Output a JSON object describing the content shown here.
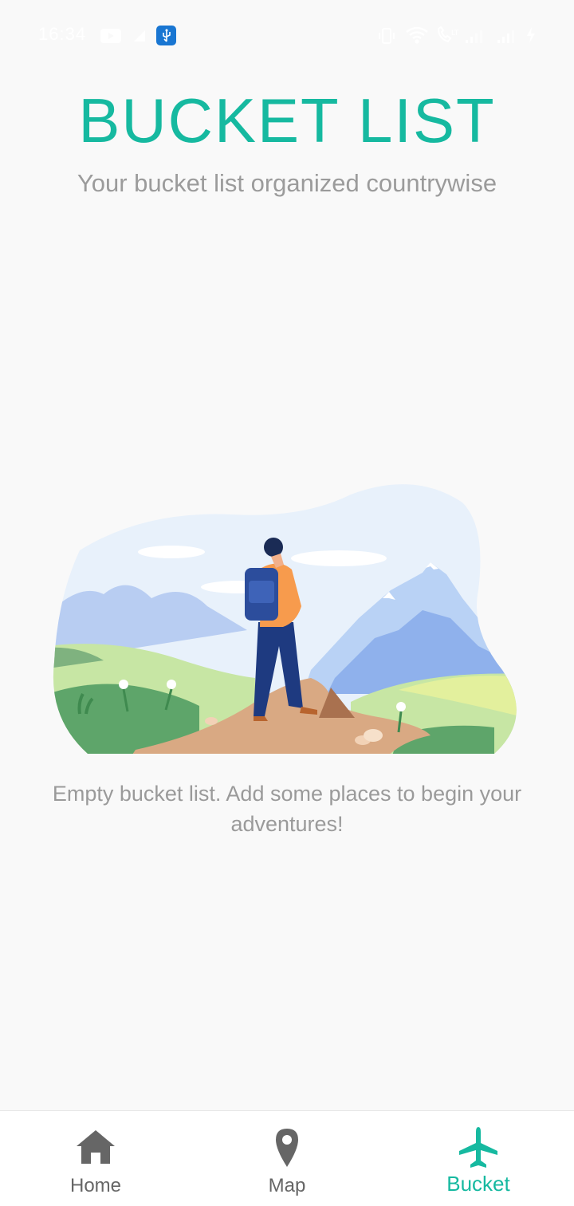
{
  "status_bar": {
    "time": "16:34",
    "icons": [
      "video-icon",
      "arrow-icon",
      "usb-icon",
      "vibrate-icon",
      "wifi-icon",
      "call-icon",
      "signal-icon",
      "signal-icon",
      "charging-icon"
    ]
  },
  "header": {
    "title": "BUCKET LIST",
    "subtitle": "Your bucket list organized countrywise"
  },
  "empty_state": {
    "message": "Empty bucket list. Add some places to begin your adventures!"
  },
  "bottom_nav": {
    "items": [
      {
        "label": "Home",
        "icon": "home-icon",
        "active": false
      },
      {
        "label": "Map",
        "icon": "map-pin-icon",
        "active": false
      },
      {
        "label": "Bucket",
        "icon": "airplane-icon",
        "active": true
      }
    ]
  },
  "colors": {
    "accent": "#16b9a0",
    "inactive": "#666666",
    "text_muted": "#9b9b9b",
    "background": "#f9f9f9"
  }
}
